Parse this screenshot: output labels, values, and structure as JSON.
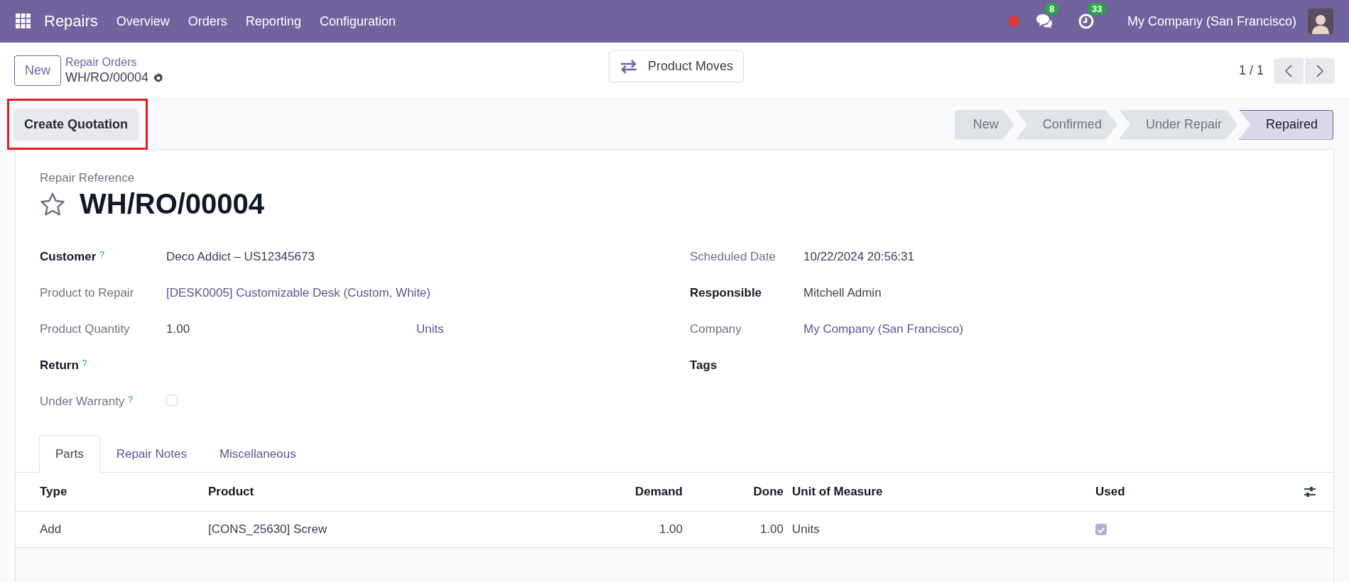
{
  "navbar": {
    "app": "Repairs",
    "menu": [
      "Overview",
      "Orders",
      "Reporting",
      "Configuration"
    ],
    "messages_count": "8",
    "activities_count": "33",
    "company": "My Company (San Francisco)"
  },
  "control_panel": {
    "new_button": "New",
    "breadcrumb": "Repair Orders",
    "record": "WH/RO/00004",
    "smart_button": "Product Moves",
    "pager": "1 / 1"
  },
  "action_buttons": [
    {
      "label": "Create Quotation",
      "highlighted": true
    }
  ],
  "stages": [
    {
      "label": "New",
      "selected": false
    },
    {
      "label": "Confirmed",
      "selected": false
    },
    {
      "label": "Under Repair",
      "selected": false
    },
    {
      "label": "Repaired",
      "selected": true
    }
  ],
  "form": {
    "reference_label": "Repair Reference",
    "title": "WH/RO/00004",
    "starred": false,
    "left_fields": [
      {
        "label": "Customer",
        "required": true,
        "help": "?",
        "kind": "text",
        "value": "Deco Addict – US12345673"
      },
      {
        "label": "Product to Repair",
        "required": false,
        "kind": "link",
        "value": "[DESK0005] Customizable Desk (Custom, White)"
      },
      {
        "label": "Product Quantity",
        "required": false,
        "kind": "quantity",
        "value": "1.00",
        "unit": "Units"
      },
      {
        "label": "Return",
        "required": true,
        "help": "?",
        "kind": "empty"
      },
      {
        "label": "Under Warranty",
        "required": false,
        "help": "?",
        "kind": "checkbox",
        "checked": false
      }
    ],
    "right_fields": [
      {
        "label": "Scheduled Date",
        "required": false,
        "kind": "text",
        "value": "10/22/2024 20:56:31"
      },
      {
        "label": "Responsible",
        "required": true,
        "kind": "text",
        "value": "Mitchell Admin"
      },
      {
        "label": "Company",
        "required": false,
        "kind": "link",
        "value": "My Company (San Francisco)"
      },
      {
        "label": "Tags",
        "required": true,
        "kind": "empty"
      }
    ]
  },
  "tabs": [
    {
      "label": "Parts",
      "selected": true
    },
    {
      "label": "Repair Notes",
      "selected": false
    },
    {
      "label": "Miscellaneous",
      "selected": false
    }
  ],
  "table": {
    "columns": [
      "Type",
      "Product",
      "Demand",
      "Done",
      "Unit of Measure",
      "Used"
    ],
    "rows": [
      {
        "cells": [
          "Add",
          "[CONS_25630] Screw",
          "1.00",
          "1.00",
          "Units"
        ],
        "used": true
      }
    ]
  }
}
